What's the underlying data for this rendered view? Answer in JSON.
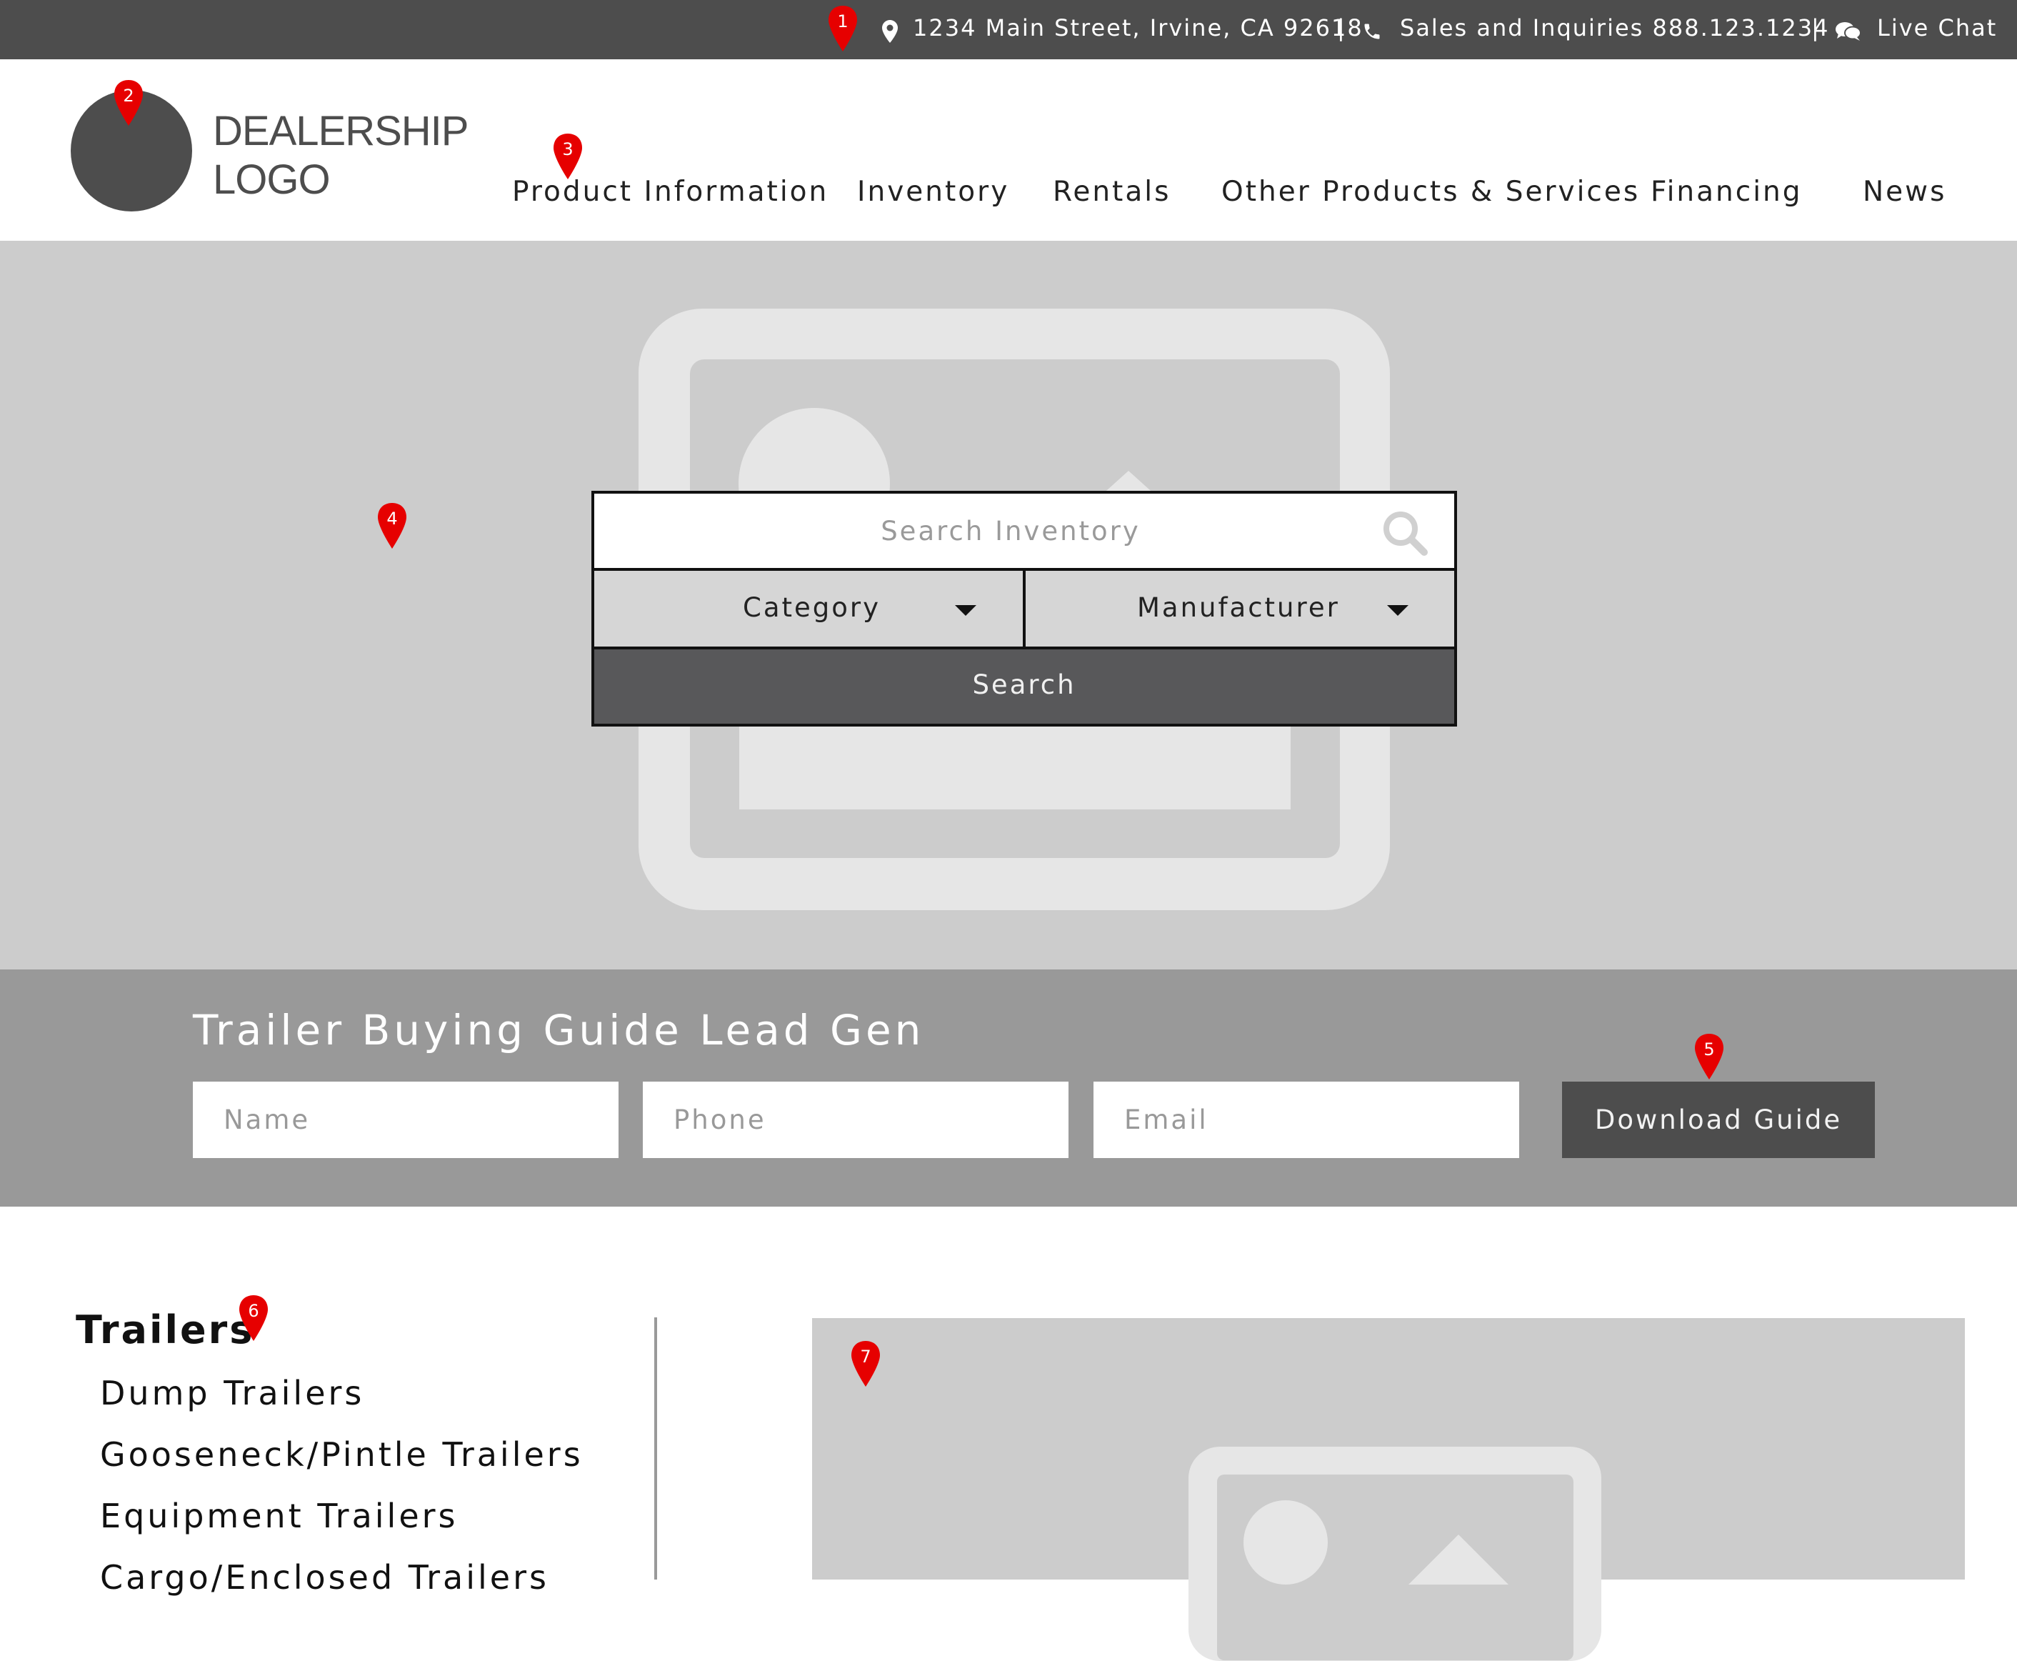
{
  "topbar": {
    "address": "1234 Main Street, Irvine, CA 92618",
    "phone": "Sales and Inquiries 888.123.1234",
    "chat": "Live Chat",
    "separator": "|"
  },
  "logo": {
    "line1": "DEALERSHIP",
    "line2": "LOGO"
  },
  "nav": [
    {
      "label": "Product Information"
    },
    {
      "label": "Inventory"
    },
    {
      "label": "Rentals"
    },
    {
      "label": "Other Products & Services"
    },
    {
      "label": "Financing"
    },
    {
      "label": "News"
    }
  ],
  "search": {
    "placeholder": "Search Inventory",
    "category": "Category",
    "manufacturer": "Manufacturer",
    "button": "Search"
  },
  "leadgen": {
    "title": "Trailer Buying Guide Lead Gen",
    "name_placeholder": "Name",
    "phone_placeholder": "Phone",
    "email_placeholder": "Email",
    "button": "Download Guide"
  },
  "categories": {
    "title": "Trailers",
    "items": [
      "Dump Trailers",
      "Gooseneck/Pintle Trailers",
      "Equipment Trailers",
      "Cargo/Enclosed Trailers"
    ]
  },
  "annotations": [
    "1",
    "2",
    "3",
    "4",
    "5",
    "6",
    "7"
  ],
  "colors": {
    "dark_gray": "#4d4d4d",
    "hero_gray": "#cccccc",
    "band_gray": "#999999",
    "pin_red": "#e60000"
  }
}
